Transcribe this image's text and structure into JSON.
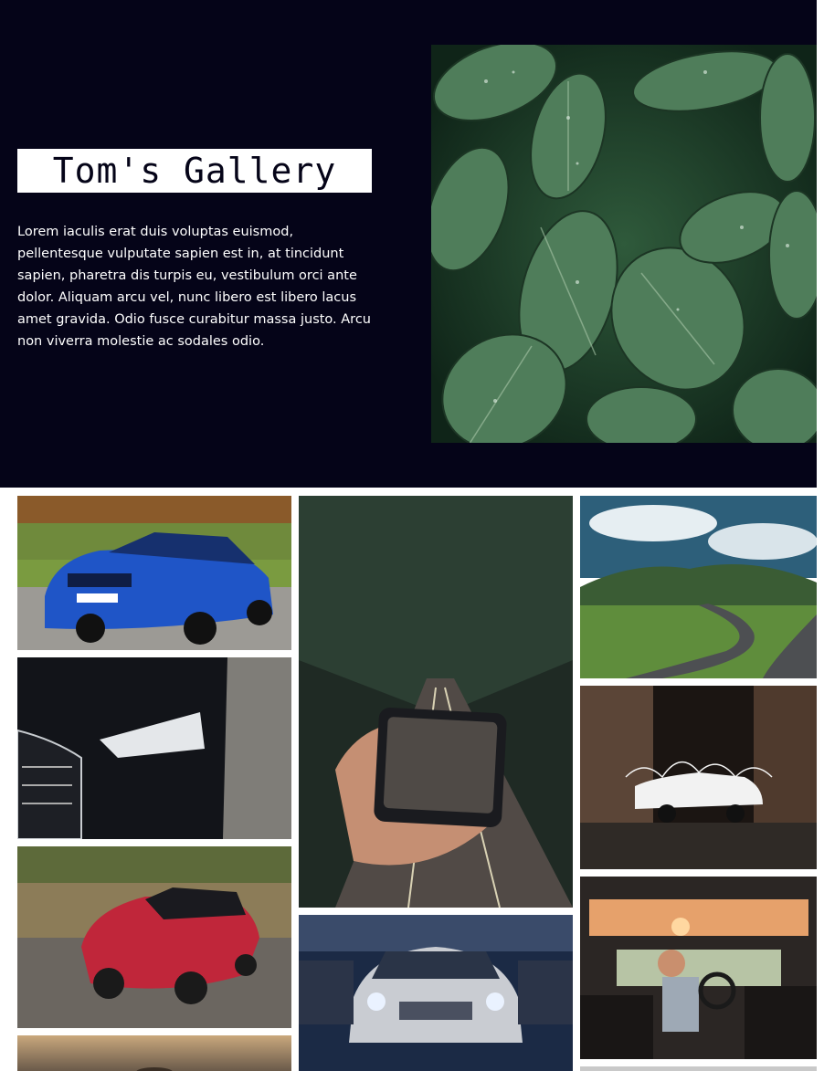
{
  "header": {
    "title": "Tom's Gallery",
    "intro": "Lorem iaculis erat duis voluptas euismod, pellentesque vulputate sapien est in, at tincidunt sapien, pharetra dis turpis eu, vestibulum orci ante dolor. Aliquam arcu vel, nunc libero est libero lacus amet gravida. Odio fusce curabitur massa justo. Arcu non viverra molestie ac sodales odio."
  },
  "colors": {
    "hero_background": "#050418",
    "title_box": "#ffffff",
    "text": "#ffffff"
  },
  "gallery": {
    "images": [
      {
        "name": "blue-car-photo",
        "subject": "blue sedan on road"
      },
      {
        "name": "black-car-headlight-photo",
        "subject": "dark car headlight close-up"
      },
      {
        "name": "red-sports-car-photo",
        "subject": "red sports car driving"
      },
      {
        "name": "sunset-car-photo",
        "subject": "car at sunset"
      },
      {
        "name": "phone-road-photo",
        "subject": "hand holding phone over forest road"
      },
      {
        "name": "silver-mercedes-photo",
        "subject": "silver Mercedes in parking garage"
      },
      {
        "name": "mountain-road-photo",
        "subject": "winding mountain road"
      },
      {
        "name": "white-car-night-photo",
        "subject": "white car at night with light painting"
      },
      {
        "name": "man-driving-photo",
        "subject": "man driving car with sunroof"
      }
    ]
  }
}
